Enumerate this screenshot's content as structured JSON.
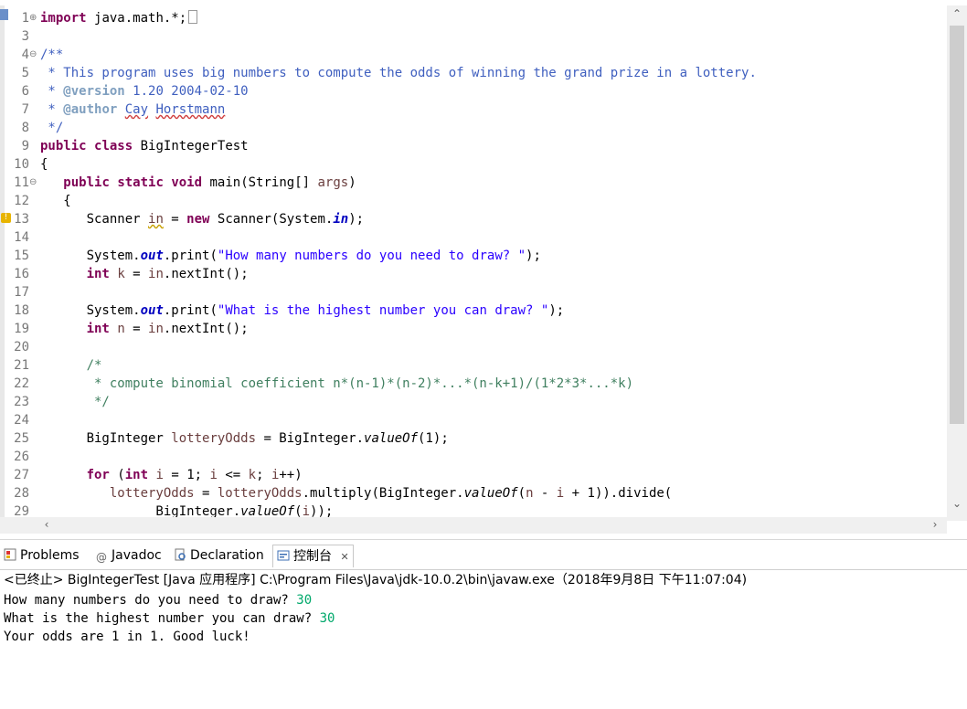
{
  "editor": {
    "lines": [
      {
        "n": "1",
        "fold": "plus",
        "segs": [
          [
            "kw",
            "import"
          ],
          [
            "",
            "java.math.*;"
          ]
        ],
        "box": true
      },
      {
        "n": "3",
        "segs": []
      },
      {
        "n": "4",
        "fold": "minus",
        "segs": [
          [
            "jd",
            "/**"
          ]
        ]
      },
      {
        "n": "5",
        "segs": [
          [
            "jd",
            " * This program uses big numbers to compute the odds of winning the grand prize in a lottery."
          ]
        ]
      },
      {
        "n": "6",
        "segs": [
          [
            "jd",
            " * "
          ],
          [
            "jt",
            "@version"
          ],
          [
            "jd",
            " 1.20 2004-02-10"
          ]
        ]
      },
      {
        "n": "7",
        "segs": [
          [
            "jd",
            " * "
          ],
          [
            "jt",
            "@author"
          ],
          [
            "jd",
            " "
          ],
          [
            "jd wavyred",
            "Cay"
          ],
          [
            "jd",
            " "
          ],
          [
            "jd wavyred",
            "Horstmann"
          ]
        ]
      },
      {
        "n": "8",
        "segs": [
          [
            "jd",
            " */"
          ]
        ]
      },
      {
        "n": "9",
        "segs": [
          [
            "kw",
            "public"
          ],
          [
            "",
            " "
          ],
          [
            "kw",
            "class"
          ],
          [
            "",
            " BigIntegerTest"
          ]
        ]
      },
      {
        "n": "10",
        "segs": [
          [
            "",
            "{"
          ]
        ]
      },
      {
        "n": "11",
        "fold": "minus",
        "segs": [
          [
            "",
            "   "
          ],
          [
            "kw",
            "public"
          ],
          [
            "",
            " "
          ],
          [
            "kw",
            "static"
          ],
          [
            "",
            " "
          ],
          [
            "kw",
            "void"
          ],
          [
            "",
            " main(String[] "
          ],
          [
            "var",
            "args"
          ],
          [
            "",
            ")"
          ]
        ]
      },
      {
        "n": "12",
        "segs": [
          [
            "",
            "   {"
          ]
        ]
      },
      {
        "n": "13",
        "warn": true,
        "segs": [
          [
            "",
            "      Scanner "
          ],
          [
            "var wavy",
            "in"
          ],
          [
            "",
            " = "
          ],
          [
            "kw",
            "new"
          ],
          [
            "",
            " Scanner(System."
          ],
          [
            "fld",
            "in"
          ],
          [
            "",
            ");"
          ]
        ]
      },
      {
        "n": "14",
        "segs": []
      },
      {
        "n": "15",
        "segs": [
          [
            "",
            "      System."
          ],
          [
            "fld",
            "out"
          ],
          [
            "",
            ".print("
          ],
          [
            "st",
            "\"How many numbers do you need to draw? \""
          ],
          [
            "",
            ");"
          ]
        ]
      },
      {
        "n": "16",
        "segs": [
          [
            "",
            "      "
          ],
          [
            "kw",
            "int"
          ],
          [
            "",
            " "
          ],
          [
            "var",
            "k"
          ],
          [
            "",
            " = "
          ],
          [
            "var",
            "in"
          ],
          [
            "",
            ".nextInt();"
          ]
        ]
      },
      {
        "n": "17",
        "segs": []
      },
      {
        "n": "18",
        "segs": [
          [
            "",
            "      System."
          ],
          [
            "fld",
            "out"
          ],
          [
            "",
            ".print("
          ],
          [
            "st",
            "\"What is the highest number you can draw? \""
          ],
          [
            "",
            ");"
          ]
        ]
      },
      {
        "n": "19",
        "segs": [
          [
            "",
            "      "
          ],
          [
            "kw",
            "int"
          ],
          [
            "",
            " "
          ],
          [
            "var",
            "n"
          ],
          [
            "",
            " = "
          ],
          [
            "var",
            "in"
          ],
          [
            "",
            ".nextInt();"
          ]
        ]
      },
      {
        "n": "20",
        "segs": []
      },
      {
        "n": "21",
        "segs": [
          [
            "cm",
            "      /*"
          ]
        ]
      },
      {
        "n": "22",
        "segs": [
          [
            "cm",
            "       * compute binomial coefficient n*(n-1)*(n-2)*...*(n-k+1)/(1*2*3*...*k)"
          ]
        ]
      },
      {
        "n": "23",
        "segs": [
          [
            "cm",
            "       */"
          ]
        ]
      },
      {
        "n": "24",
        "segs": []
      },
      {
        "n": "25",
        "segs": [
          [
            "",
            "      BigInteger "
          ],
          [
            "var",
            "lotteryOdds"
          ],
          [
            "",
            " = BigInteger."
          ],
          [
            "mth",
            "valueOf"
          ],
          [
            "",
            "(1);"
          ]
        ]
      },
      {
        "n": "26",
        "segs": []
      },
      {
        "n": "27",
        "segs": [
          [
            "",
            "      "
          ],
          [
            "kw",
            "for"
          ],
          [
            "",
            " ("
          ],
          [
            "kw",
            "int"
          ],
          [
            "",
            " "
          ],
          [
            "var",
            "i"
          ],
          [
            "",
            " = 1; "
          ],
          [
            "var",
            "i"
          ],
          [
            "",
            " <= "
          ],
          [
            "var",
            "k"
          ],
          [
            "",
            "; "
          ],
          [
            "var",
            "i"
          ],
          [
            "",
            "++)"
          ]
        ]
      },
      {
        "n": "28",
        "segs": [
          [
            "",
            "         "
          ],
          [
            "var",
            "lotteryOdds"
          ],
          [
            "",
            " = "
          ],
          [
            "var",
            "lotteryOdds"
          ],
          [
            "",
            ".multiply(BigInteger."
          ],
          [
            "mth",
            "valueOf"
          ],
          [
            "",
            "("
          ],
          [
            "var",
            "n"
          ],
          [
            "",
            " - "
          ],
          [
            "var",
            "i"
          ],
          [
            "",
            " + 1)).divide("
          ]
        ]
      },
      {
        "n": "29",
        "segs": [
          [
            "",
            "               BigInteger."
          ],
          [
            "mth",
            "valueOf"
          ],
          [
            "",
            "("
          ],
          [
            "var",
            "i"
          ],
          [
            "",
            "));"
          ]
        ]
      }
    ]
  },
  "views": {
    "problems": "Problems",
    "javadoc": "Javadoc",
    "declaration": "Declaration",
    "console": "控制台",
    "close": "✕"
  },
  "console": {
    "status": "<已终止> BigIntegerTest [Java 应用程序] C:\\Program Files\\Java\\jdk-10.0.2\\bin\\javaw.exe（2018年9月8日 下午11:07:04)",
    "lines": [
      {
        "text": "How many numbers do you need to draw? ",
        "input": "30"
      },
      {
        "text": "What is the highest number you can draw? ",
        "input": "30"
      },
      {
        "text": "Your odds are 1 in 1. Good luck!",
        "input": ""
      }
    ]
  },
  "colors": {
    "keyword": "#7f0055",
    "comment": "#3f7f5f",
    "javadoc": "#3f5fbf",
    "string": "#2a00ff",
    "field": "#0000c0",
    "console_input": "#00a86b"
  }
}
